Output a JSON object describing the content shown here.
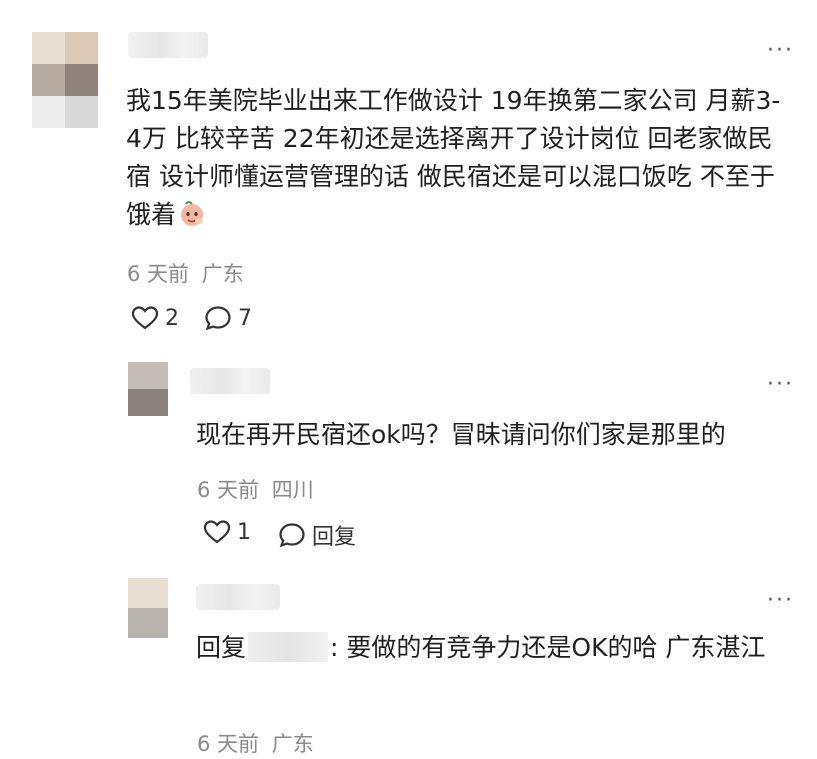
{
  "comment": {
    "text": "我15年美院毕业出来工作做设计 19年换第二家公司 月薪3-4万 比较辛苦 22年初还是选择离开了设计岗位 回老家做民宿 设计师懂运营管理的话 做民宿还是可以混口饭吃 不至于饿着",
    "emoji": "peach-face-emoji",
    "time": "6 天前",
    "location": "广东",
    "likes": "2",
    "replies": "7",
    "more": "···"
  },
  "reply1": {
    "text": "现在再开民宿还ok吗？冒昧请问你们家是那里的",
    "time": "6 天前",
    "location": "四川",
    "likes": "1",
    "reply_label": "回复",
    "more": "···"
  },
  "reply2": {
    "prefix": "回复",
    "suffix": ": 要做的有竞争力还是OK的哈 广东湛江",
    "time": "6 天前",
    "location": "广东",
    "more": "···"
  },
  "colors": {
    "text": "#1f1f1f",
    "meta": "#8a8a8a",
    "icon": "#333333"
  }
}
